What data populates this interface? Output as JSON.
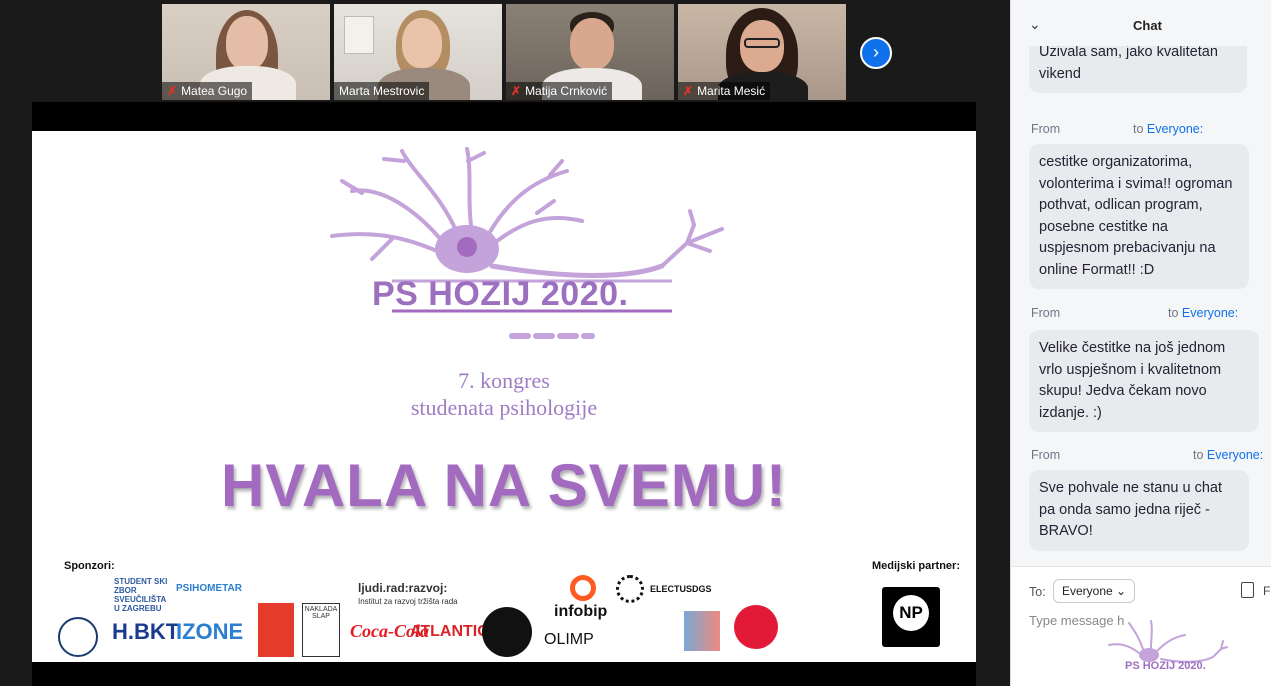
{
  "participants": [
    {
      "name": "Matea Gugo",
      "muted": true
    },
    {
      "name": "Marta Mestrovic",
      "muted": false
    },
    {
      "name": "Matija Crnković",
      "muted": true
    },
    {
      "name": "Marita Mesić",
      "muted": true
    }
  ],
  "next_icon": "chevron-right-icon",
  "slide": {
    "logo_text": "PS HOZIJ 2020.",
    "subtitle_line1": "7. kongres",
    "subtitle_line2": "studenata psihologije",
    "headline": "HVALA NA SVEMU!",
    "sponsors_label": "Sponzori:",
    "media_partner_label": "Medijski partner:",
    "sponsors_row1": [
      "STUDENT SKI ZBOR SVEUČILIŠTA U ZAGREBU",
      "PSIHOMETAR",
      "ljudi.rad:razvoj:",
      "Institut za razvoj tržišta rada",
      "ELECTUSDGS"
    ],
    "sponsors_row2": [
      "H.BKT",
      "IZONE",
      "NAKLADA SLAP",
      "Coca-Cola",
      "ATLANTIC",
      "infobip",
      "OLIMP"
    ],
    "media_partner": "NP",
    "accent_color": "#a36bc0"
  },
  "chat": {
    "title": "Chat",
    "messages": [
      {
        "text": "Uzivala sam, jako kvalitetan vikend"
      },
      {
        "from": "From",
        "to_prefix": "to",
        "to": "Everyone:",
        "text": "cestitke organizatorima, volonterima i svima!! ogroman pothvat, odlican program, posebne cestitke na uspjesnom prebacivanju na online Format!! :D"
      },
      {
        "from": "From",
        "to_prefix": "to",
        "to": "Everyone:",
        "text": "Velike čestitke na još jednom vrlo uspješnom i kvalitetnom skupu! Jedva čekam novo izdanje. :)"
      },
      {
        "from": "From",
        "to_prefix": "to",
        "to": "Everyone:",
        "text": "Sve pohvale ne stanu u chat pa onda samo jedna riječ - BRAVO!"
      }
    ],
    "to_label": "To:",
    "recipient": "Everyone",
    "file_letter": "F",
    "placeholder": "Type message h",
    "mini_logo_text": "PS HOZIJ 2020."
  }
}
